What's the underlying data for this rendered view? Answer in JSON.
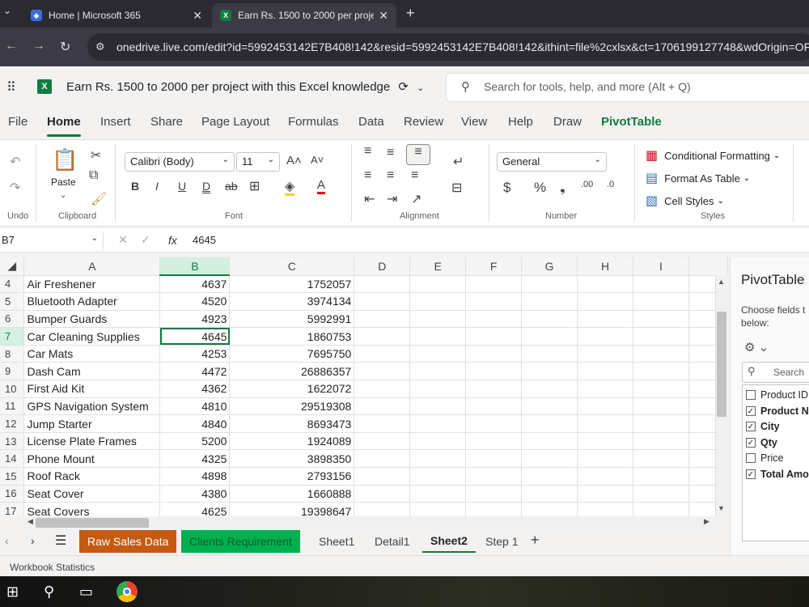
{
  "browser": {
    "tabs": [
      {
        "title": "Home | Microsoft 365",
        "active": false
      },
      {
        "title": "Earn Rs. 1500 to 2000 per proje",
        "active": true
      }
    ],
    "url": "onedrive.live.com/edit?id=5992453142E7B408!142&resid=5992453142E7B408!142&ithint=file%2cxlsx&ct=1706199127748&wdOrigin=OFFIC"
  },
  "excel": {
    "doc_title": "Earn Rs. 1500 to 2000 per project with this Excel knowledge",
    "search_placeholder": "Search for tools, help, and more (Alt + Q)",
    "menu": [
      "File",
      "Home",
      "Insert",
      "Share",
      "Page Layout",
      "Formulas",
      "Data",
      "Review",
      "View",
      "Help",
      "Draw",
      "PivotTable"
    ],
    "ribbon": {
      "undo_label": "Undo",
      "clipboard_label": "Clipboard",
      "paste_label": "Paste",
      "font_label": "Font",
      "font_name": "Calibri (Body)",
      "font_size": "11",
      "alignment_label": "Alignment",
      "number_label": "Number",
      "number_format": "General",
      "styles_label": "Styles",
      "cond_format": "Conditional Formatting",
      "format_table": "Format As Table",
      "cell_styles": "Cell Styles"
    },
    "name_box": "B7",
    "formula_value": "4645",
    "columns": [
      "A",
      "B",
      "C",
      "D",
      "E",
      "F",
      "G",
      "H",
      "I"
    ],
    "rows": [
      {
        "n": "4",
        "a": "Air Freshener",
        "b": "4637",
        "c": "1752057"
      },
      {
        "n": "5",
        "a": "Bluetooth Adapter",
        "b": "4520",
        "c": "3974134"
      },
      {
        "n": "6",
        "a": "Bumper Guards",
        "b": "4923",
        "c": "5992991"
      },
      {
        "n": "7",
        "a": "Car Cleaning Supplies",
        "b": "4645",
        "c": "1860753"
      },
      {
        "n": "8",
        "a": "Car Mats",
        "b": "4253",
        "c": "7695750"
      },
      {
        "n": "9",
        "a": "Dash Cam",
        "b": "4472",
        "c": "26886357"
      },
      {
        "n": "10",
        "a": "First Aid Kit",
        "b": "4362",
        "c": "1622072"
      },
      {
        "n": "11",
        "a": "GPS Navigation System",
        "b": "4810",
        "c": "29519308"
      },
      {
        "n": "12",
        "a": "Jump Starter",
        "b": "4840",
        "c": "8693473"
      },
      {
        "n": "13",
        "a": "License Plate Frames",
        "b": "5200",
        "c": "1924089"
      },
      {
        "n": "14",
        "a": "Phone Mount",
        "b": "4325",
        "c": "3898350"
      },
      {
        "n": "15",
        "a": "Roof Rack",
        "b": "4898",
        "c": "2793156"
      },
      {
        "n": "16",
        "a": "Seat Cover",
        "b": "4380",
        "c": "1660888"
      },
      {
        "n": "17",
        "a": "Seat Covers",
        "b": "4625",
        "c": "19398647"
      }
    ],
    "pivot": {
      "title": "PivotTable",
      "desc": "Choose fields t below:",
      "search": "Search",
      "fields": [
        {
          "label": "Product ID",
          "checked": false,
          "bold": false
        },
        {
          "label": "Product N",
          "checked": true,
          "bold": true
        },
        {
          "label": "City",
          "checked": true,
          "bold": true
        },
        {
          "label": "Qty",
          "checked": true,
          "bold": true
        },
        {
          "label": "Price",
          "checked": false,
          "bold": false
        },
        {
          "label": "Total Amo",
          "checked": true,
          "bold": true
        }
      ]
    },
    "sheets": [
      {
        "label": "Raw Sales Data",
        "color": "#c55a11"
      },
      {
        "label": "Clients Requirement",
        "color": "#00b050"
      },
      {
        "label": "Sheet1",
        "color": ""
      },
      {
        "label": "Detail1",
        "color": ""
      },
      {
        "label": "Sheet2",
        "color": "",
        "active": true
      },
      {
        "label": "Step 1",
        "color": ""
      }
    ],
    "status": "Workbook Statistics"
  }
}
